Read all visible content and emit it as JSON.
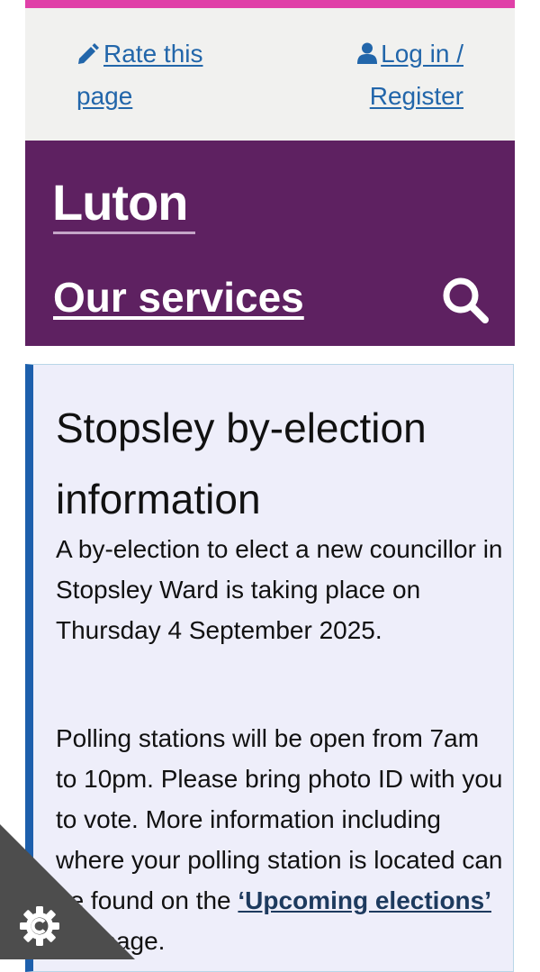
{
  "utility": {
    "rate_label": "Rate this page",
    "login_label": "Log in / Register"
  },
  "header": {
    "logo_text": "Luton",
    "services_label": "Our services"
  },
  "notice": {
    "title": "Stopsley by-election information",
    "para1": "A by-election to elect a new councillor in Stopsley Ward is taking place on Thursday 4 September 2025.",
    "para2_before": "Polling stations will be open from 7am to 10pm. Please bring photo ID with you to vote. More information including where your polling station is located can be found on the ",
    "para2_link": "‘Upcoming elections’",
    "para2_after": " webpage."
  },
  "colors": {
    "brand_purple": "#5e2161",
    "accent_pink": "#e040a8",
    "link_blue": "#2266aa",
    "notice_border": "#1d5fac",
    "notice_bg": "#eeeefa"
  },
  "icons": {
    "rate": "pencil-icon",
    "login": "user-icon",
    "search": "search-icon",
    "cookie": "cookie-settings-icon"
  }
}
